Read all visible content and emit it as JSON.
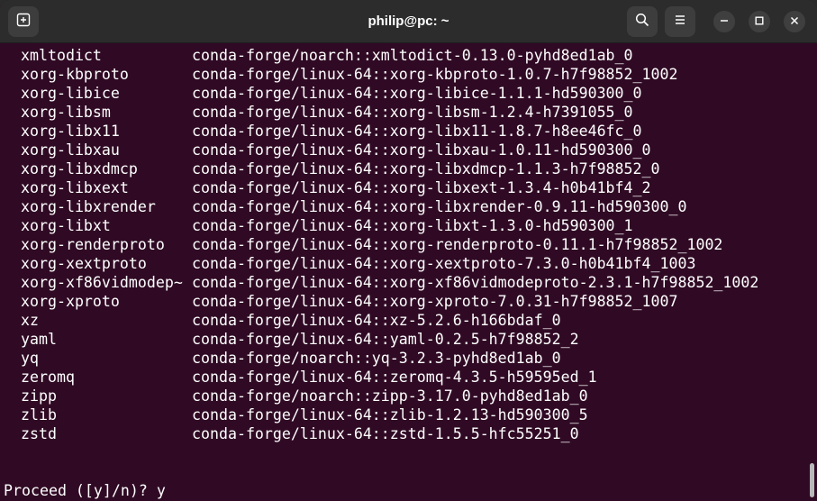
{
  "window": {
    "title": "philip@pc: ~"
  },
  "icons": {
    "new_tab": "new-tab-icon",
    "search": "search-icon",
    "menu": "hamburger-menu-icon",
    "minimize": "minimize-icon",
    "maximize": "maximize-icon",
    "close": "close-icon"
  },
  "terminal": {
    "rows": [
      {
        "pkg": "xmltodict",
        "src": "conda-forge/noarch::xmltodict-0.13.0-pyhd8ed1ab_0"
      },
      {
        "pkg": "xorg-kbproto",
        "src": "conda-forge/linux-64::xorg-kbproto-1.0.7-h7f98852_1002"
      },
      {
        "pkg": "xorg-libice",
        "src": "conda-forge/linux-64::xorg-libice-1.1.1-hd590300_0"
      },
      {
        "pkg": "xorg-libsm",
        "src": "conda-forge/linux-64::xorg-libsm-1.2.4-h7391055_0"
      },
      {
        "pkg": "xorg-libx11",
        "src": "conda-forge/linux-64::xorg-libx11-1.8.7-h8ee46fc_0"
      },
      {
        "pkg": "xorg-libxau",
        "src": "conda-forge/linux-64::xorg-libxau-1.0.11-hd590300_0"
      },
      {
        "pkg": "xorg-libxdmcp",
        "src": "conda-forge/linux-64::xorg-libxdmcp-1.1.3-h7f98852_0"
      },
      {
        "pkg": "xorg-libxext",
        "src": "conda-forge/linux-64::xorg-libxext-1.3.4-h0b41bf4_2"
      },
      {
        "pkg": "xorg-libxrender",
        "src": "conda-forge/linux-64::xorg-libxrender-0.9.11-hd590300_0"
      },
      {
        "pkg": "xorg-libxt",
        "src": "conda-forge/linux-64::xorg-libxt-1.3.0-hd590300_1"
      },
      {
        "pkg": "xorg-renderproto",
        "src": "conda-forge/linux-64::xorg-renderproto-0.11.1-h7f98852_1002"
      },
      {
        "pkg": "xorg-xextproto",
        "src": "conda-forge/linux-64::xorg-xextproto-7.3.0-h0b41bf4_1003"
      },
      {
        "pkg": "xorg-xf86vidmodep~",
        "src": "conda-forge/linux-64::xorg-xf86vidmodeproto-2.3.1-h7f98852_1002"
      },
      {
        "pkg": "xorg-xproto",
        "src": "conda-forge/linux-64::xorg-xproto-7.0.31-h7f98852_1007"
      },
      {
        "pkg": "xz",
        "src": "conda-forge/linux-64::xz-5.2.6-h166bdaf_0"
      },
      {
        "pkg": "yaml",
        "src": "conda-forge/linux-64::yaml-0.2.5-h7f98852_2"
      },
      {
        "pkg": "yq",
        "src": "conda-forge/noarch::yq-3.2.3-pyhd8ed1ab_0"
      },
      {
        "pkg": "zeromq",
        "src": "conda-forge/linux-64::zeromq-4.3.5-h59595ed_1"
      },
      {
        "pkg": "zipp",
        "src": "conda-forge/noarch::zipp-3.17.0-pyhd8ed1ab_0"
      },
      {
        "pkg": "zlib",
        "src": "conda-forge/linux-64::zlib-1.2.13-hd590300_5"
      },
      {
        "pkg": "zstd",
        "src": "conda-forge/linux-64::zstd-1.5.5-hfc55251_0"
      }
    ],
    "prompt": "Proceed ([y]/n)? y"
  }
}
